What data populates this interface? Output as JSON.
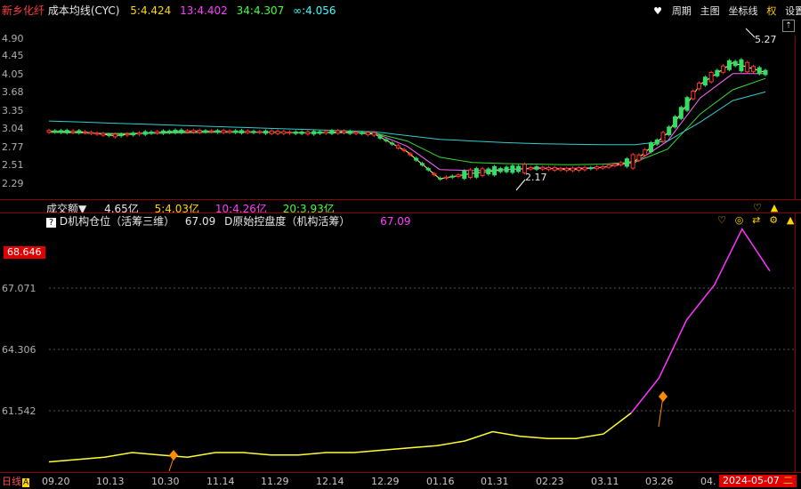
{
  "top": {
    "stock_name": "新乡化纤",
    "indicator": "成本均线(CYC)",
    "ma5": "5:4.424",
    "ma13": "13:4.402",
    "ma34": "34:4.307",
    "mainf": "∞:4.056",
    "toolbar": [
      "周期",
      "主图",
      "坐标线",
      "权",
      "设置"
    ],
    "y_ticks": [
      "4.90",
      "4.45",
      "4.05",
      "3.68",
      "3.35",
      "3.04",
      "2.77",
      "2.51",
      "2.29"
    ],
    "high_label": "5.27",
    "low_label": "2.17"
  },
  "vol": {
    "title": "成交额▼",
    "value": "4.65亿",
    "ma5": "5:4.03亿",
    "ma10": "10:4.26亿",
    "ma20": "20:3.93亿"
  },
  "ind": {
    "help": "?",
    "name1": "D机构仓位（活筹三维）",
    "val1": "67.09",
    "name2": "D原始控盘度（机构活筹）",
    "val2": "67.09",
    "current_badge": "68.646",
    "y_ticks": [
      "67.071",
      "64.306",
      "61.542"
    ]
  },
  "bottom": {
    "period": "日线",
    "dates": [
      "09.20",
      "10.13",
      "10.30",
      "11.14",
      "11.29",
      "12.14",
      "12.29",
      "01.16",
      "01.31",
      "02.23",
      "03.11",
      "03.26",
      "04."
    ],
    "current_date": "2024-05-07",
    "current_suffix": "二"
  },
  "chart_data": [
    {
      "type": "line",
      "title": "成本均线(CYC)",
      "series": [
        {
          "name": "5",
          "color": "#ffff66",
          "values": [
            3.33,
            3.32,
            3.25,
            3.3,
            3.33,
            3.33,
            3.32,
            3.31,
            3.3,
            3.32,
            3.28,
            2.95,
            2.45,
            2.55,
            2.62,
            2.65,
            2.62,
            2.66,
            2.78,
            3.3,
            4.2,
            4.6,
            4.42
          ]
        },
        {
          "name": "13",
          "color": "#ff66ff",
          "values": [
            3.32,
            3.3,
            3.28,
            3.3,
            3.32,
            3.32,
            3.32,
            3.31,
            3.3,
            3.31,
            3.3,
            3.05,
            2.62,
            2.6,
            2.62,
            2.64,
            2.64,
            2.66,
            2.75,
            3.15,
            3.95,
            4.4,
            4.4
          ]
        },
        {
          "name": "34",
          "color": "#33dd33",
          "values": [
            3.31,
            3.3,
            3.29,
            3.29,
            3.3,
            3.31,
            3.31,
            3.31,
            3.3,
            3.3,
            3.3,
            3.15,
            2.85,
            2.75,
            2.73,
            2.72,
            2.71,
            2.72,
            2.76,
            3.0,
            3.65,
            4.1,
            4.31
          ]
        },
        {
          "name": "∞",
          "color": "#33cccc",
          "values": [
            3.52,
            3.5,
            3.48,
            3.46,
            3.44,
            3.42,
            3.4,
            3.38,
            3.36,
            3.34,
            3.32,
            3.25,
            3.18,
            3.15,
            3.12,
            3.1,
            3.09,
            3.08,
            3.08,
            3.15,
            3.5,
            3.9,
            4.06
          ]
        }
      ],
      "ylim": [
        2.17,
        5.27
      ]
    },
    {
      "type": "line",
      "title": "D机构仓位（活筹三维）",
      "series": [
        {
          "name": "D机构仓位（活筹三维）",
          "values": [
            58.9,
            59.0,
            59.1,
            59.3,
            59.2,
            59.1,
            59.3,
            59.3,
            59.2,
            59.2,
            59.3,
            59.3,
            59.4,
            59.5,
            59.6,
            59.8,
            60.2,
            60.0,
            59.9,
            59.9,
            60.1,
            61.0,
            62.5,
            65.0,
            66.5,
            68.9,
            67.1
          ]
        }
      ],
      "ylim": [
        58.5,
        69.0
      ]
    }
  ]
}
